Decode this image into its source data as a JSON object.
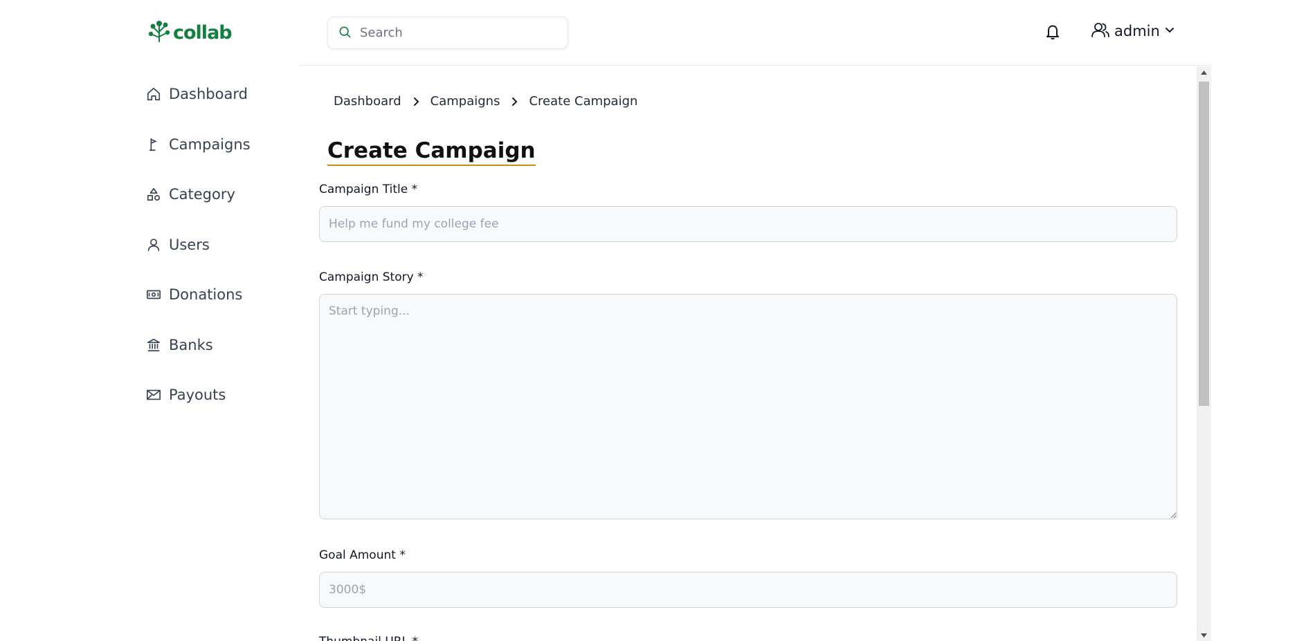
{
  "brand": {
    "name": "collab",
    "color": "#12803f"
  },
  "sidebar": {
    "items": [
      {
        "label": "Dashboard",
        "icon": "home-icon"
      },
      {
        "label": "Campaigns",
        "icon": "flag-icon"
      },
      {
        "label": "Category",
        "icon": "shapes-icon"
      },
      {
        "label": "Users",
        "icon": "user-icon"
      },
      {
        "label": "Donations",
        "icon": "money-icon"
      },
      {
        "label": "Banks",
        "icon": "bank-icon"
      },
      {
        "label": "Payouts",
        "icon": "envelope-icon"
      }
    ]
  },
  "header": {
    "search_placeholder": "Search",
    "user_name": "admin"
  },
  "breadcrumb": [
    "Dashboard",
    "Campaigns",
    "Create Campaign"
  ],
  "page": {
    "title": "Create Campaign",
    "title_underline_color": "#d08b10"
  },
  "form": {
    "title_label": "Campaign Title *",
    "title_placeholder": "Help me fund my college fee",
    "story_label": "Campaign Story *",
    "story_placeholder": "Start typing...",
    "goal_label": "Goal Amount *",
    "goal_placeholder": "3000$",
    "thumbnail_label": "Thumbnail URL *"
  }
}
